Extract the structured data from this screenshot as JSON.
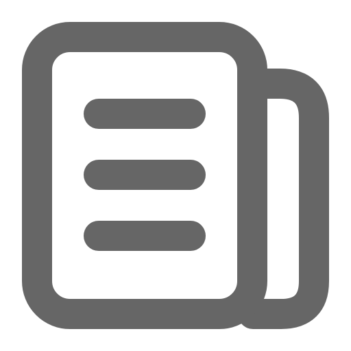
{
  "icon": {
    "name": "newspaper-icon",
    "stroke_color": "#666666",
    "background_color": "#ffffff",
    "text_line_count": 3
  }
}
